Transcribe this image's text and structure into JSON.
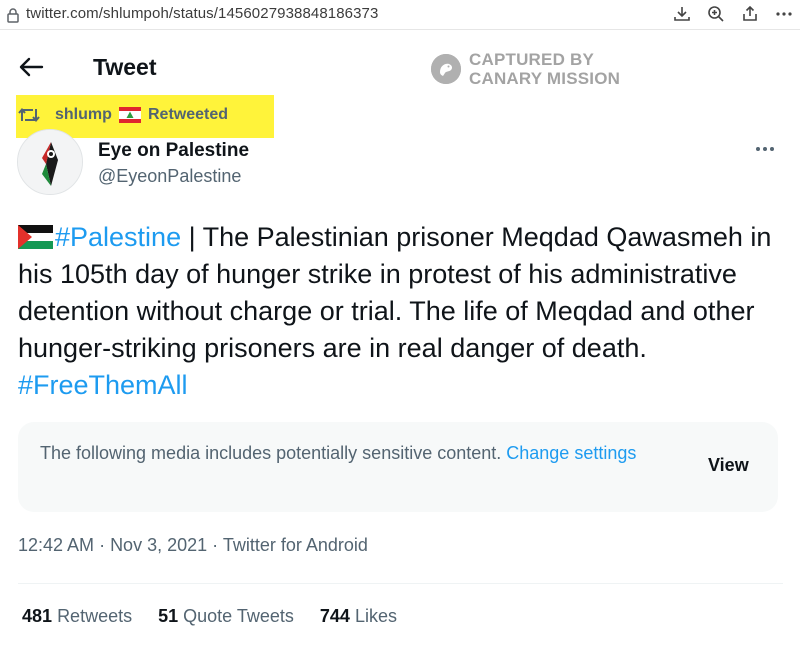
{
  "browser": {
    "url": "twitter.com/shlumpoh/status/1456027938848186373",
    "icons": [
      "lock-icon",
      "download-icon",
      "zoom-icon",
      "share-icon",
      "more-icon"
    ]
  },
  "header": {
    "title": "Tweet"
  },
  "watermark": {
    "line1": "CAPTURED BY",
    "line2": "CANARY MISSION"
  },
  "retweet": {
    "user": "shlump",
    "label": "Retweeted",
    "highlight_color": "#fff33a"
  },
  "author": {
    "name": "Eye on Palestine",
    "handle": "@EyeonPalestine"
  },
  "tweet": {
    "hashtag1": "#Palestine",
    "text": " | The Palestinian prisoner Meqdad Qawasmeh in his 105th day of hunger strike in protest of his administrative detention without charge or trial. The life of Meqdad and other hunger-striking prisoners are in real danger of death. ",
    "hashtag2": "#FreeThemAll"
  },
  "sensitive": {
    "message": "The following media includes potentially sensitive content. ",
    "link": "Change settings",
    "view_label": "View"
  },
  "meta": {
    "time": "12:42 AM",
    "date": "Nov 3, 2021",
    "source": "Twitter for Android",
    "separator": " · "
  },
  "stats": {
    "retweets_count": "481",
    "retweets_label": "Retweets",
    "quotes_count": "51",
    "quotes_label": "Quote Tweets",
    "likes_count": "744",
    "likes_label": "Likes"
  },
  "colors": {
    "link_blue": "#1d9bf0",
    "secondary_text": "#536471",
    "primary_text": "#0f1419"
  }
}
